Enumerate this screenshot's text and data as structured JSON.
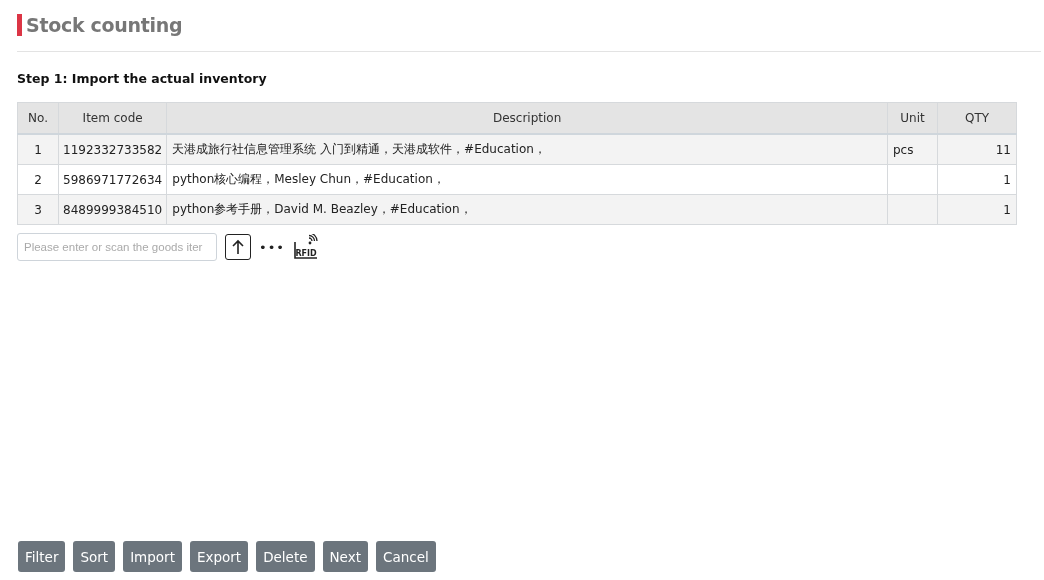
{
  "title": "Stock counting",
  "step": "Step 1: Import the actual inventory",
  "table": {
    "columns": [
      "No.",
      "Item code",
      "Description",
      "Unit",
      "QTY"
    ],
    "rows": [
      [
        "1",
        "1192332733582",
        "天港成旅行社信息管理系统 入门到精通，天港成软件，#Education，",
        "pcs",
        "11"
      ],
      [
        "2",
        "5986971772634",
        "python核心编程，Mesley Chun，#Education，",
        "",
        "1"
      ],
      [
        "3",
        "8489999384510",
        "python参考手册，David M. Beazley，#Education，",
        "",
        "1"
      ]
    ]
  },
  "scan": {
    "placeholder": "Please enter or scan the goods iter",
    "more": "•••",
    "rfid_label": "RFID"
  },
  "buttons": [
    "Filter",
    "Sort",
    "Import",
    "Export",
    "Delete",
    "Next",
    "Cancel"
  ]
}
